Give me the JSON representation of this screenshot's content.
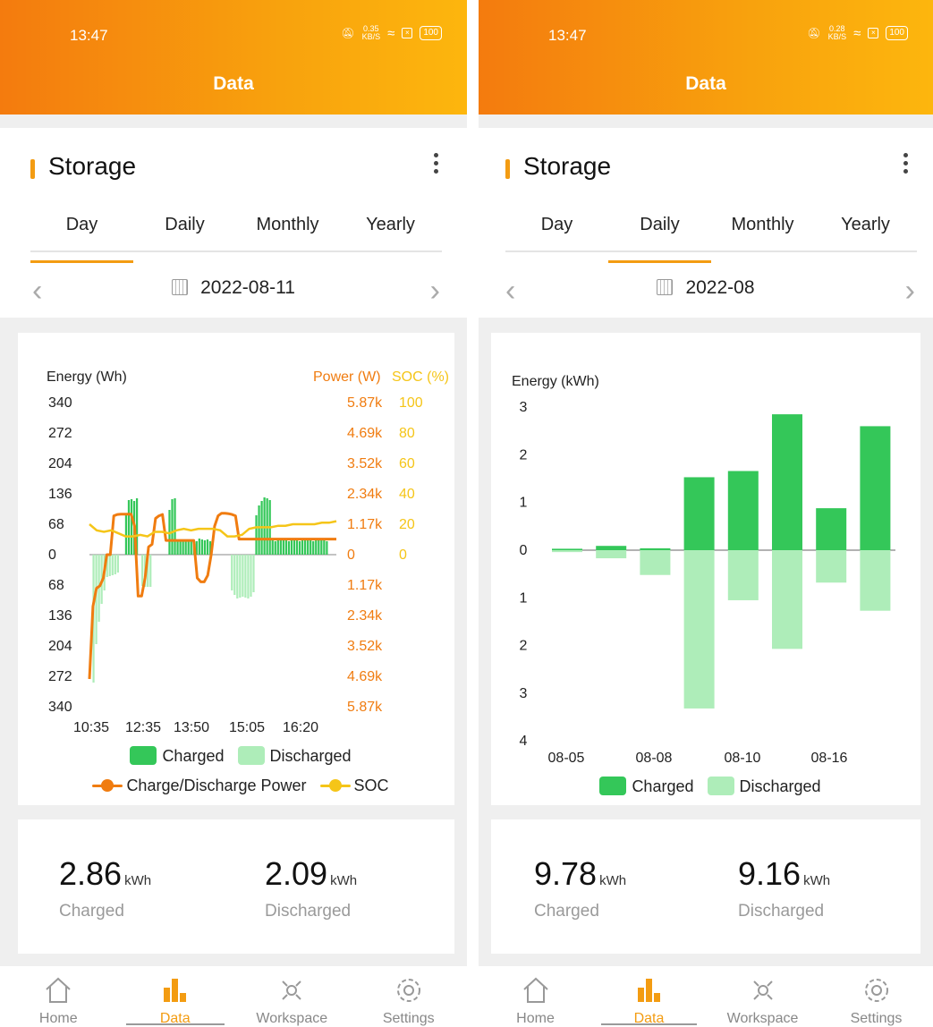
{
  "screens": [
    {
      "status": {
        "time": "13:47",
        "speed": "0.35\nKB/S",
        "battery": "100"
      },
      "app_title": "Data",
      "section_title": "Storage",
      "tabs": [
        "Day",
        "Daily",
        "Monthly",
        "Yearly"
      ],
      "active_tab": 0,
      "date": "2022-08-11",
      "chart_title_left": "Energy (Wh)",
      "chart_title_power": "Power (W)",
      "chart_title_soc": "SOC (%)",
      "legend": {
        "charged": "Charged",
        "discharged": "Discharged",
        "power": "Charge/Discharge Power",
        "soc": "SOC"
      },
      "stats": {
        "charged_value": "2.86",
        "charged_unit": "kWh",
        "charged_label": "Charged",
        "discharged_value": "2.09",
        "discharged_unit": "kWh",
        "discharged_label": "Discharged"
      }
    },
    {
      "status": {
        "time": "13:47",
        "speed": "0.28\nKB/S",
        "battery": "100"
      },
      "app_title": "Data",
      "section_title": "Storage",
      "tabs": [
        "Day",
        "Daily",
        "Monthly",
        "Yearly"
      ],
      "active_tab": 1,
      "date": "2022-08",
      "chart_title_left": "Energy (kWh)",
      "legend": {
        "charged": "Charged",
        "discharged": "Discharged"
      },
      "stats": {
        "charged_value": "9.78",
        "charged_unit": "kWh",
        "charged_label": "Charged",
        "discharged_value": "9.16",
        "discharged_unit": "kWh",
        "discharged_label": "Discharged"
      }
    }
  ],
  "nav": [
    "Home",
    "Data",
    "Workspace",
    "Settings"
  ],
  "colors": {
    "accent": "#f39c12",
    "charged": "#34c759",
    "discharged": "#aeedb9",
    "power": "#f07c10",
    "soc": "#f5c518"
  },
  "chart_data": [
    {
      "type": "bar",
      "title": "",
      "ylabel": "Energy (Wh)",
      "y2label": "Power (W)",
      "y3label": "SOC (%)",
      "energy_ticks": [
        "340",
        "272",
        "204",
        "136",
        "68",
        "0",
        "68",
        "136",
        "204",
        "272",
        "340"
      ],
      "power_ticks": [
        "5.87k",
        "4.69k",
        "3.52k",
        "2.34k",
        "1.17k",
        "0",
        "1.17k",
        "2.34k",
        "3.52k",
        "4.69k",
        "5.87k"
      ],
      "soc_ticks": [
        "100",
        "80",
        "60",
        "40",
        "20",
        "0"
      ],
      "x_ticks": [
        "10:35",
        "12:35",
        "13:50",
        "15:05",
        "16:20"
      ],
      "ylim": [
        -340,
        340
      ],
      "series": [
        {
          "name": "Charged",
          "values": [
            0,
            0,
            0,
            0,
            0,
            0,
            0,
            0,
            0,
            0,
            0,
            0,
            0,
            90,
            122,
            124,
            120,
            126,
            0,
            0,
            0,
            0,
            0,
            0,
            0,
            0,
            0,
            0,
            0,
            100,
            124,
            126,
            30,
            32,
            34,
            32,
            30,
            34,
            32,
            30,
            36,
            34,
            32,
            34,
            30,
            0,
            0,
            0,
            0,
            0,
            0,
            0,
            0,
            0,
            0,
            0,
            0,
            0,
            0,
            0,
            0,
            88,
            110,
            120,
            128,
            126,
            122,
            34,
            30,
            34,
            36,
            32,
            34,
            30,
            36,
            32,
            34,
            30,
            36,
            32,
            34,
            36,
            30,
            34,
            32,
            36,
            34,
            30,
            0,
            0,
            0
          ]
        },
        {
          "name": "Discharged",
          "values": [
            0,
            -286,
            -200,
            -150,
            -110,
            -80,
            -50,
            -48,
            -46,
            -44,
            -40,
            0,
            0,
            0,
            0,
            0,
            0,
            0,
            0,
            -70,
            -72,
            -72,
            -72,
            0,
            0,
            0,
            0,
            0,
            0,
            0,
            0,
            0,
            0,
            0,
            0,
            0,
            0,
            0,
            0,
            0,
            0,
            0,
            0,
            0,
            0,
            0,
            0,
            0,
            0,
            0,
            0,
            0,
            -80,
            -90,
            -98,
            -96,
            -94,
            -96,
            -98,
            -94,
            -84,
            0,
            0,
            0,
            0,
            0,
            0,
            0,
            0,
            0,
            0,
            0,
            0,
            0,
            0,
            0,
            0,
            0,
            0,
            0,
            0,
            0,
            0,
            0,
            0,
            0,
            0,
            0,
            0,
            0,
            0
          ]
        },
        {
          "name": "Charge/Discharge Power",
          "values": [
            -4800,
            -2000,
            -1300,
            -1200,
            -900,
            0,
            0,
            1500,
            1550,
            1560,
            1560,
            1560,
            1560,
            1100,
            -1600,
            -1600,
            -900,
            300,
            400,
            1400,
            1500,
            1550,
            550,
            550,
            550,
            550,
            550,
            550,
            550,
            550,
            550,
            -900,
            -1050,
            -1050,
            -800,
            0,
            1100,
            1500,
            1600,
            1600,
            1580,
            1550,
            1500,
            600,
            600,
            600,
            600,
            600,
            600,
            600,
            600,
            600,
            600,
            600,
            600,
            600,
            600,
            600,
            600,
            600,
            600,
            600,
            600,
            600,
            600,
            600,
            600,
            600,
            600,
            600,
            600,
            600
          ]
        },
        {
          "name": "SOC",
          "values": [
            20,
            16,
            15,
            16,
            14,
            12,
            12,
            13,
            12,
            15,
            15,
            14,
            16,
            17,
            16,
            17,
            17,
            17,
            16,
            12,
            12,
            13,
            17,
            18,
            18,
            18,
            19,
            19,
            20,
            20,
            20,
            20,
            21,
            21,
            22
          ]
        }
      ]
    },
    {
      "type": "bar",
      "title": "",
      "ylabel": "Energy (kWh)",
      "y_ticks": [
        "3",
        "2",
        "1",
        "0",
        "1",
        "2",
        "3",
        "4"
      ],
      "x_ticks": [
        "08-05",
        "08-08",
        "08-10",
        "08-16"
      ],
      "ylim": [
        -4,
        3
      ],
      "categories": [
        "d1",
        "d2",
        "d3",
        "d4",
        "d5",
        "d6",
        "d7",
        "d8"
      ],
      "series": [
        {
          "name": "Charged",
          "values": [
            0.03,
            0.09,
            0.04,
            1.53,
            1.66,
            2.85,
            0.88,
            2.6
          ]
        },
        {
          "name": "Discharged",
          "values": [
            -0.04,
            -0.17,
            -0.52,
            -3.32,
            -1.05,
            -2.07,
            -0.68,
            -1.27
          ]
        }
      ]
    }
  ]
}
